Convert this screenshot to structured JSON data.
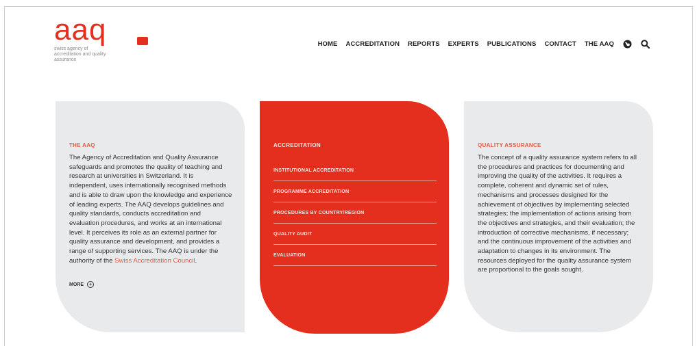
{
  "logo": {
    "wordmark": "aaq",
    "tagline": "swiss agency of accreditation and quality assurance"
  },
  "nav": {
    "items": [
      "HOME",
      "ACCREDITATION",
      "REPORTS",
      "EXPERTS",
      "PUBLICATIONS",
      "CONTACT",
      "THE AAQ"
    ],
    "globe_icon": "globe-icon",
    "search_icon": "search-icon"
  },
  "cards": {
    "about": {
      "title": "THE AAQ",
      "text": "The Agency of Accreditation and Quality Assurance safeguards and promotes the quality of teaching and research at universities in Switzerland. It is independent, uses internationally recognised methods and is able to draw upon the knowledge and experience of leading experts. The AAQ develops guidelines and quality standards, conducts accreditation and evaluation procedures, and works at an international level. It perceives its role as an external partner for quality assurance and development, and provides a range of supporting services. The AAQ is under the authority of the ",
      "link": "Swiss Accreditation Council",
      "tail": ".",
      "more": "MORE"
    },
    "accreditation": {
      "title": "ACCREDITATION",
      "items": [
        "INSTITUTIONAL ACCREDITATION",
        "PROGRAMME ACCREDITATION",
        "PROCEDURES BY COUNTRY/REGION",
        "QUALITY AUDIT",
        "EVALUATION"
      ]
    },
    "quality": {
      "title": "QUALITY ASSURANCE",
      "text": "The concept of a quality assurance system refers to all the procedures and practices for documenting and improving the quality of the activities. It requires a complete, coherent and dynamic set of rules, mechanisms and processes designed for the achievement of objectives by implementing selected strategies; the implementation of actions arising from the objectives and strategies, and their evaluation; the introduction of corrective mechanisms, if necessary; and the continuous improvement of the activities and adaptation to changes in its environment. The resources deployed for the quality assurance system are proportional to the goals sought."
    }
  },
  "colors": {
    "brand_red": "#e42f1f",
    "card_grey": "#e8eaec"
  }
}
